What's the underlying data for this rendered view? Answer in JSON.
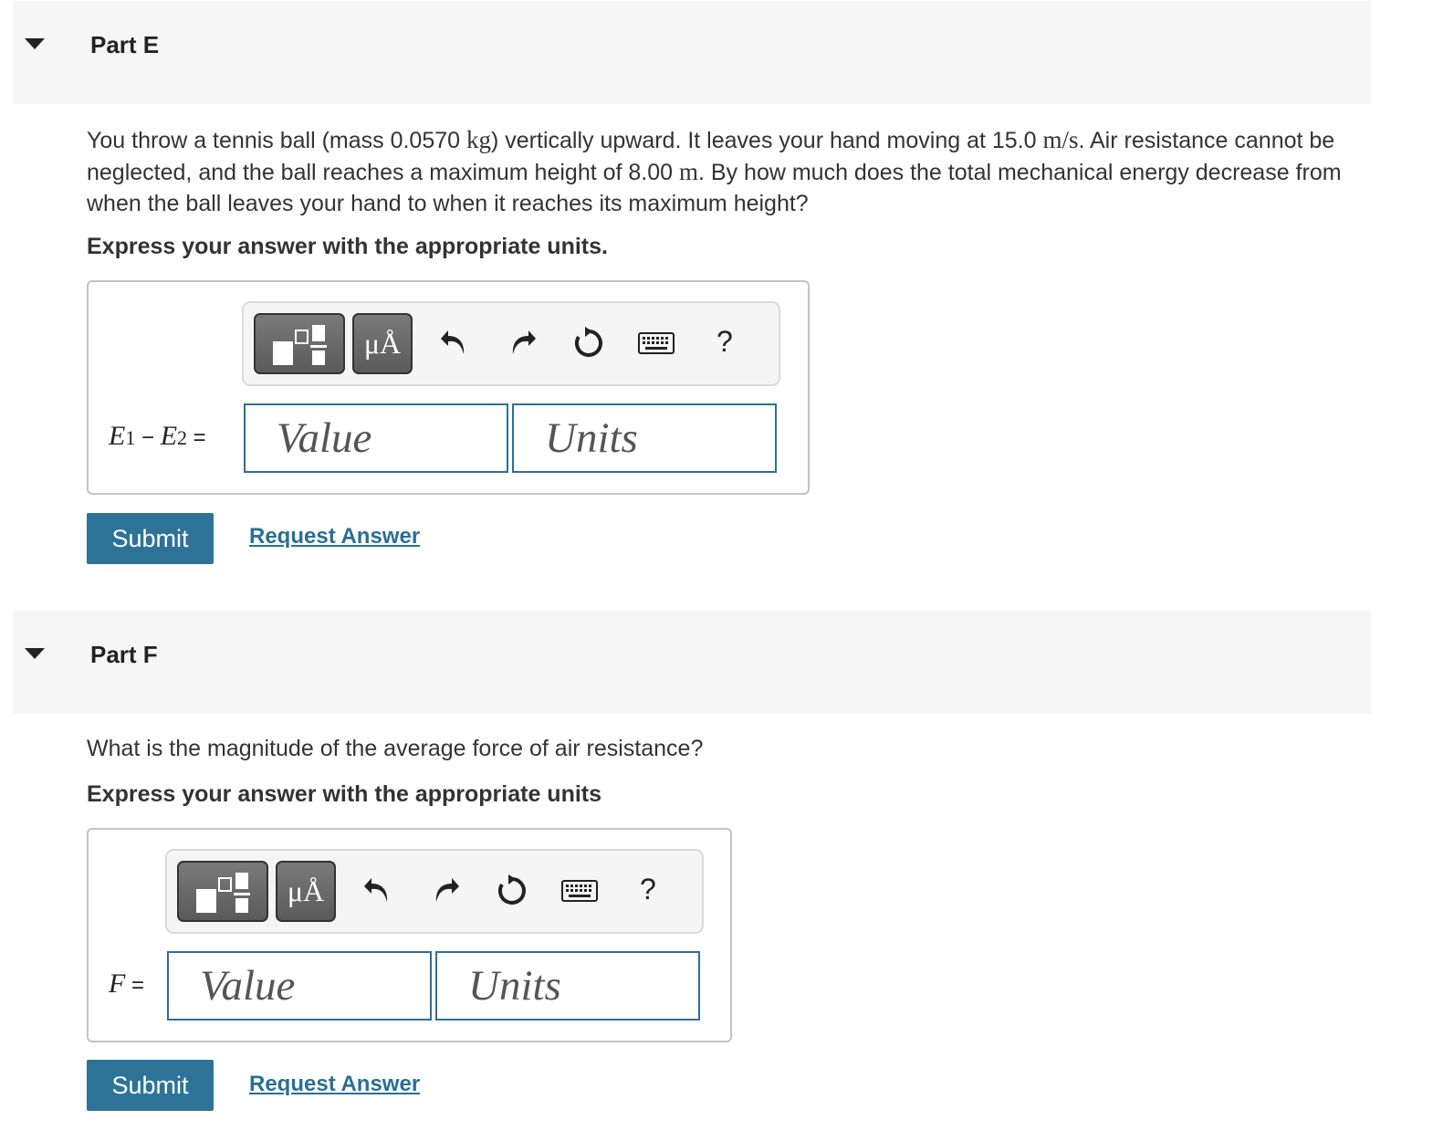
{
  "parts": [
    {
      "title": "Part E",
      "question": {
        "t1": "You throw a tennis ball (mass 0.0570 ",
        "u1": "kg",
        "t2": ") vertically upward. It leaves your hand moving at 15.0 ",
        "u2": "m/s",
        "t3": ". Air resistance cannot be neglected, and the ball reaches a maximum height of 8.00 ",
        "u3": "m",
        "t4": ". By how much does the total mechanical energy decrease from when the ball leaves your hand to when it reaches its maximum height?"
      },
      "instruction": "Express your answer with the appropriate units.",
      "label": {
        "a": "E",
        "a_sub": "1",
        "minus": " − ",
        "b": "E",
        "b_sub": "2",
        "eq": " ="
      },
      "value_placeholder": "Value",
      "units_placeholder": "Units",
      "toolbar": {
        "units_button": "μÅ",
        "help": "?"
      },
      "submit": "Submit",
      "request_answer": "Request Answer"
    },
    {
      "title": "Part F",
      "question": "What is the magnitude of the average force of air resistance?",
      "instruction": "Express your answer with the appropriate units",
      "label": {
        "a": "F",
        "eq": " ="
      },
      "value_placeholder": "Value",
      "units_placeholder": "Units",
      "toolbar": {
        "units_button": "μÅ",
        "help": "?"
      },
      "submit": "Submit",
      "request_answer": "Request Answer"
    }
  ]
}
